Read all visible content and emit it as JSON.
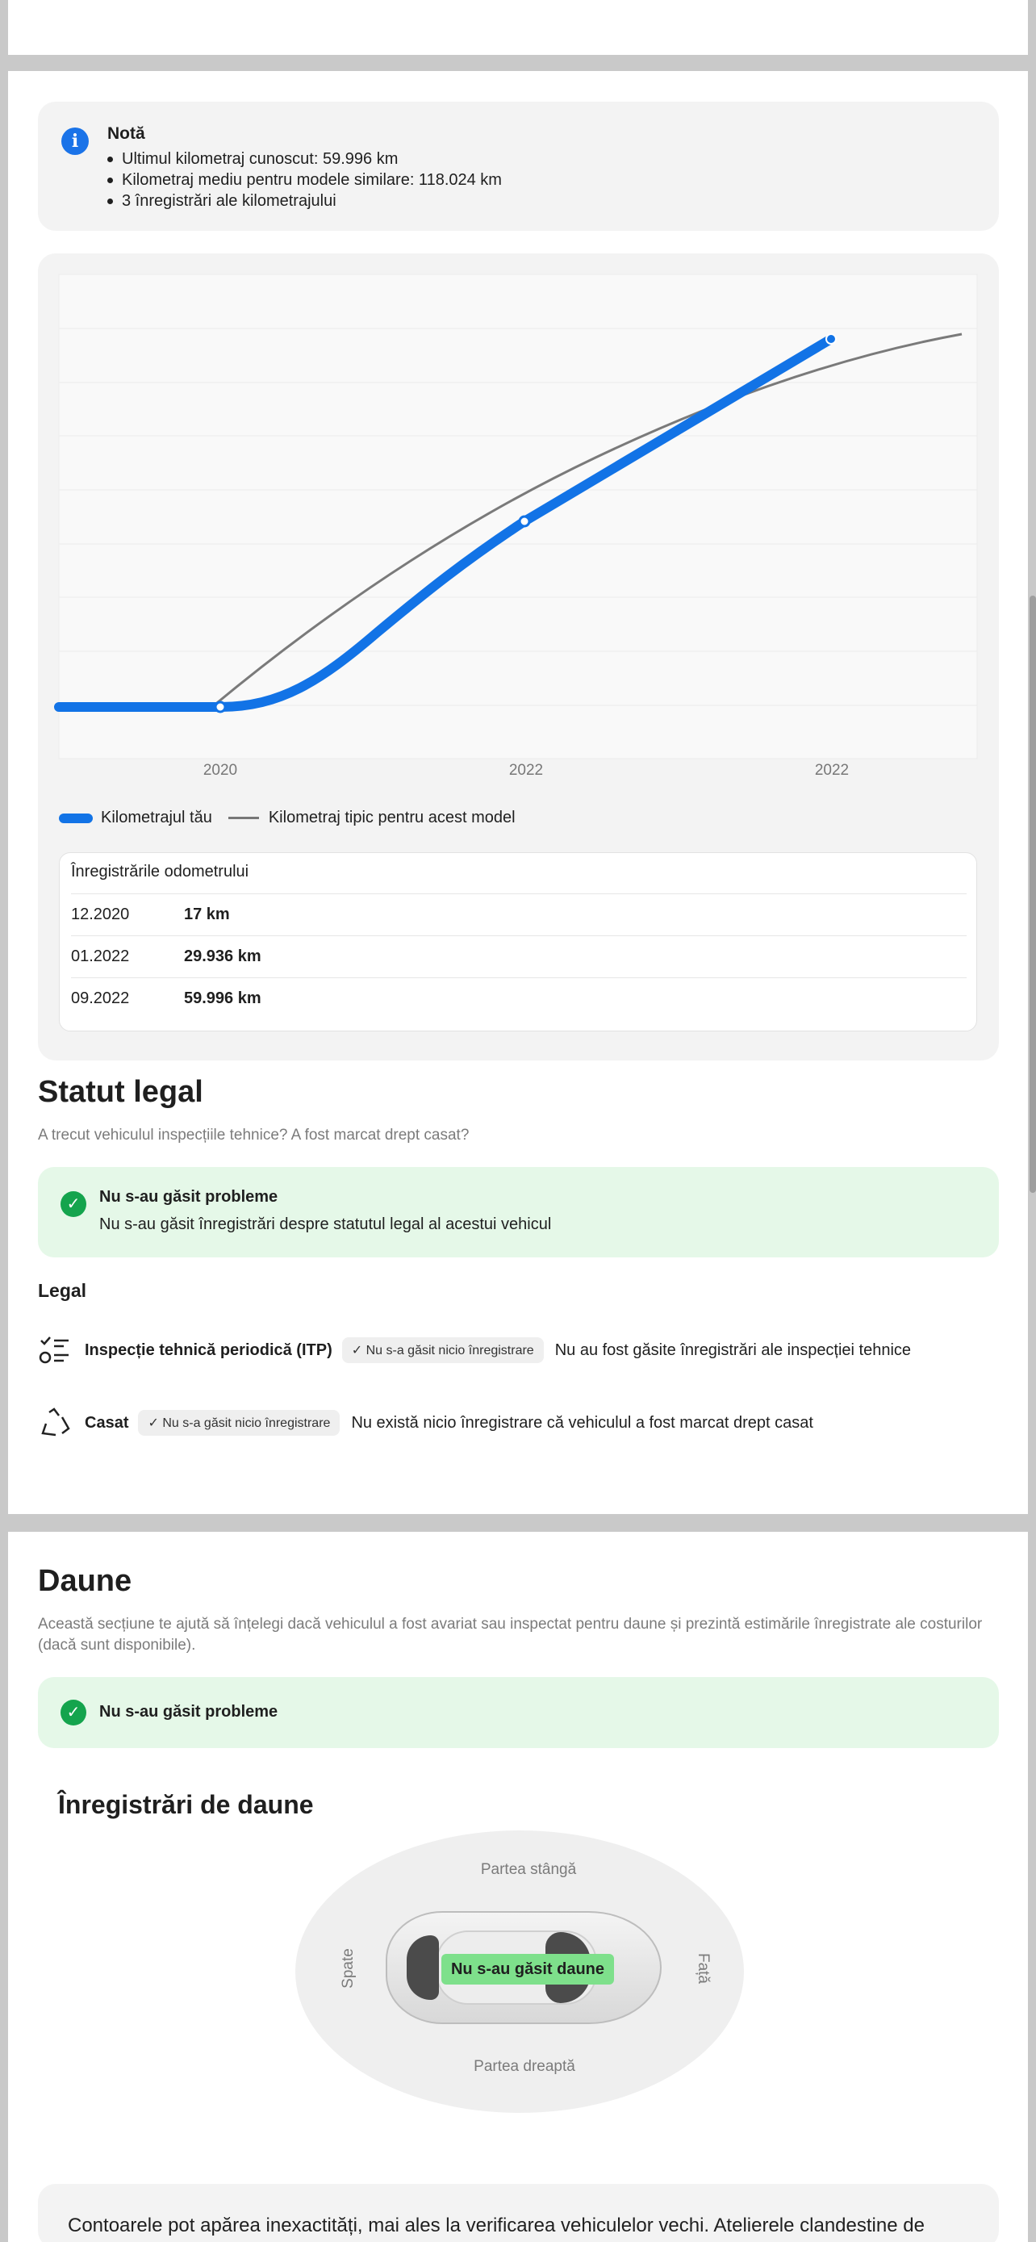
{
  "note": {
    "title": "Notă",
    "items": [
      "Ultimul kilometraj cunoscut: 59.996 km",
      "Kilometraj mediu pentru modele similare: 118.024 km",
      "3 înregistrări ale kilometrajului"
    ]
  },
  "chart_data": {
    "type": "line",
    "x_tick_labels": [
      "2020",
      "2022",
      "2022"
    ],
    "series": [
      {
        "name": "Kilometrajul tău",
        "color": "#1273e6",
        "points": [
          [
            "12.2020",
            17
          ],
          [
            "01.2022",
            29936
          ],
          [
            "09.2022",
            59996
          ]
        ]
      },
      {
        "name": "Kilometraj tipic pentru acest model",
        "color": "#777777"
      }
    ],
    "grid": true
  },
  "legend": {
    "yours": "Kilometrajul tău",
    "typical": "Kilometraj tipic pentru acest model"
  },
  "odometer": {
    "title": "Înregistrările odometrului",
    "rows": [
      {
        "date": "12.2020",
        "km": "17 km"
      },
      {
        "date": "01.2022",
        "km": "29.936 km"
      },
      {
        "date": "09.2022",
        "km": "59.996 km"
      }
    ]
  },
  "legal": {
    "title": "Statut legal",
    "subtitle": "A trecut vehiculul inspecțiile tehnice? A fost marcat drept casat?",
    "ok_title": "Nu s-au găsit probleme",
    "ok_text": "Nu s-au găsit înregistrări despre statutul legal al acestui vehicul",
    "subhead": "Legal",
    "rows": [
      {
        "label": "Inspecție tehnică periodică (ITP)",
        "badge": "Nu s-a găsit nicio înregistrare",
        "text": "Nu au fost găsite înregistrări ale inspecției tehnice",
        "icon": "checklist-icon"
      },
      {
        "label": "Casat",
        "badge": "Nu s-a găsit nicio înregistrare",
        "text": "Nu există nicio înregistrare că vehiculul a fost marcat drept casat",
        "icon": "recycle-icon"
      }
    ]
  },
  "damage": {
    "title": "Daune",
    "subtitle": "Această secțiune te ajută să înțelegi dacă vehiculul a fost avariat sau inspectat pentru daune și prezintă estimările înregistrate ale costurilor (dacă sunt disponibile).",
    "ok_title": "Nu s-au găsit probleme",
    "records_title": "Înregistrări de daune",
    "no_damage": "Nu s-au găsit daune",
    "side_left": "Partea stângă",
    "side_right": "Partea dreaptă",
    "rear": "Spate",
    "front": "Față",
    "footer": "Contoarele pot apărea inexactități, mai ales la verificarea vehiculelor vechi. Atelierele clandestine de reparații"
  }
}
